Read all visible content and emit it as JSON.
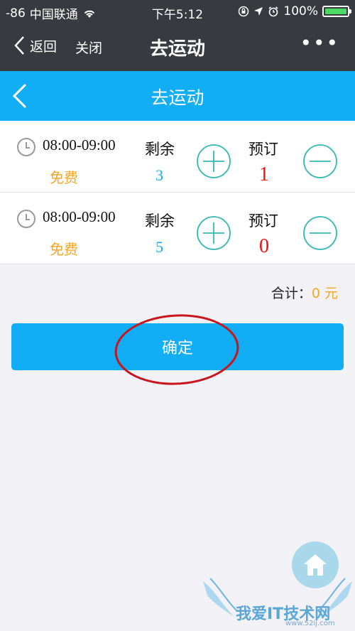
{
  "status": {
    "signal": "-86",
    "carrier": "中国联通",
    "time": "下午5:12",
    "battery": "100%"
  },
  "wechat_nav": {
    "back_label": "返回",
    "close_label": "关闭",
    "title": "去运动",
    "more": "•••"
  },
  "header": {
    "title": "去运动"
  },
  "slots": [
    {
      "time": "08:00-09:00",
      "price": "免费",
      "remaining_label": "剩余",
      "remaining": "3",
      "order_label": "预订",
      "ordered": "1"
    },
    {
      "time": "08:00-09:00",
      "price": "免费",
      "remaining_label": "剩余",
      "remaining": "5",
      "order_label": "预订",
      "ordered": "0"
    }
  ],
  "total": {
    "label": "合计：",
    "amount": "0 元"
  },
  "confirm_label": "确定",
  "watermark": {
    "text": "我爱IT技术网",
    "url": "www.52ij.com"
  },
  "colors": {
    "primary": "#12aef5",
    "accent": "#f5a623",
    "danger": "#e81313",
    "nav_bg": "#393a3f"
  }
}
